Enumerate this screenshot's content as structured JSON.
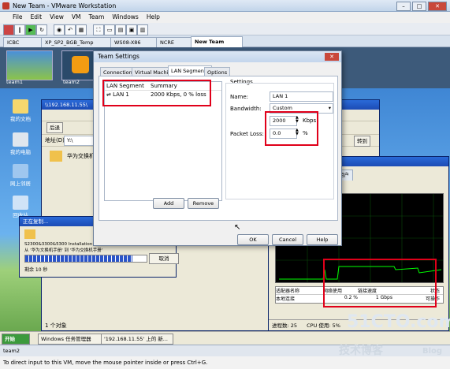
{
  "window": {
    "title": "New Team - VMware Workstation",
    "min": "–",
    "max": "□",
    "close": "✕"
  },
  "menu": [
    "File",
    "Edit",
    "View",
    "VM",
    "Team",
    "Windows",
    "Help"
  ],
  "tabs": [
    "ICBC",
    "XP_SP2_BGB_Temp",
    "WS08-X86",
    "NCRE",
    "New Team"
  ],
  "thumbs": [
    "team1",
    "team2"
  ],
  "desktop_icons": [
    "我的文档",
    "我的电脑",
    "网上邻居",
    "回收站"
  ],
  "explorer": {
    "title": "\\\\192.168.11.55\\",
    "address_label": "地址(D)",
    "address": "Y:\\",
    "back": "后退",
    "folder": "华为交换机",
    "go": "转到",
    "status": "1 个对象"
  },
  "copy_dialog": {
    "title": "正在复制...",
    "file": "S2300&3300&5300 Installation Quick Start & 快速安装指南",
    "from_to": "从 '华为文换机手册' 到 '华为交换机手册'",
    "remaining": "剩余 10 秒",
    "cancel": "取消",
    "progress": 0.88
  },
  "taskmgr": {
    "tabs": [
      "联网",
      "用户"
    ],
    "cols": [
      "适配器名称",
      "网络使用",
      "链接速度",
      "状态"
    ],
    "row": [
      "本地连接",
      "0.2 %",
      "1 Gbps",
      "可操作"
    ],
    "status_processes": "进程数: 25",
    "status_cpu": "CPU 使用: 5%"
  },
  "taskbar": {
    "start": "开始",
    "items": [
      "Windows 任务管理器",
      "'192.168.11.55' 上的 新..."
    ]
  },
  "dialog": {
    "title": "Team Settings",
    "close": "✕",
    "tabs": [
      "Connections",
      "Virtual Machines",
      "LAN Segments",
      "Options"
    ],
    "list_headers": [
      "LAN Segment",
      "Summary"
    ],
    "segments": [
      {
        "name": "LAN 1",
        "summary": "2000 Kbps, 0 % loss"
      }
    ],
    "settings_label": "Settings",
    "name_label": "Name:",
    "name_value": "LAN 1",
    "bandwidth_label": "Bandwidth:",
    "bandwidth_value": "Custom",
    "kbps_value": "2000",
    "kbps_unit": "Kbps",
    "loss_label": "Packet Loss:",
    "loss_value": "0.0",
    "loss_unit": "%",
    "add": "Add",
    "remove": "Remove",
    "ok": "OK",
    "cancel": "Cancel",
    "help": "Help"
  },
  "vm_status": "team2",
  "hint": "To direct input to this VM, move the mouse pointer inside or press Ctrl+G.",
  "watermark": {
    "brand": "51CTO.com",
    "blog": "技术博客",
    "blog_en": "Blog"
  },
  "colors": {
    "highlight": "#e0001a",
    "xp_blue": "#1c4bb5",
    "graph_bg": "#000000",
    "graph_line": "#00ff00"
  }
}
